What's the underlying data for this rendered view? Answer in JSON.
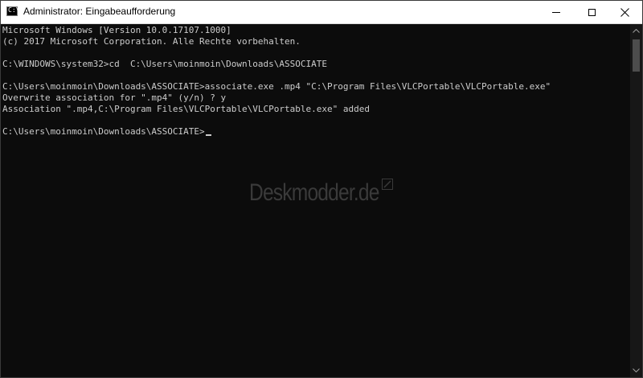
{
  "window": {
    "title": "Administrator: Eingabeaufforderung",
    "app_icon_glyph": "C:\\",
    "controls": {
      "minimize": "minimize-icon",
      "maximize": "maximize-icon",
      "close": "close-icon"
    }
  },
  "console": {
    "lines": [
      "Microsoft Windows [Version 10.0.17107.1000]",
      "(c) 2017 Microsoft Corporation. Alle Rechte vorbehalten.",
      "",
      "C:\\WINDOWS\\system32>cd  C:\\Users\\moinmoin\\Downloads\\ASSOCIATE",
      "",
      "C:\\Users\\moinmoin\\Downloads\\ASSOCIATE>associate.exe .mp4 \"C:\\Program Files\\VLCPortable\\VLCPortable.exe\"",
      "Overwrite association for \".mp4\" (y/n) ? y",
      "Association \".mp4,C:\\Program Files\\VLCPortable\\VLCPortable.exe\" added",
      "",
      "C:\\Users\\moinmoin\\Downloads\\ASSOCIATE>"
    ]
  },
  "watermark": {
    "text": "Deskmodder.de"
  },
  "colors": {
    "console_bg": "#0c0c0c",
    "console_text": "#cccccc",
    "titlebar_bg": "#ffffff",
    "watermark": "#3a3a3a"
  }
}
